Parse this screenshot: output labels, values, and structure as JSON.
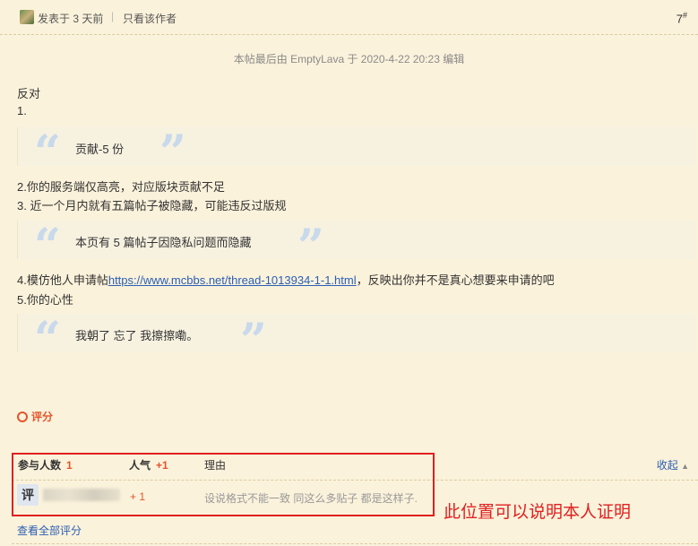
{
  "post_header": {
    "posted_prefix": "发表于",
    "posted_time": "3 天前",
    "separator": "|",
    "author_only": "只看该作者",
    "floor": "7",
    "floor_mark": "#"
  },
  "edit_notice": "本帖最后由 EmptyLava 于 2020-4-22 20:23 编辑",
  "content": {
    "line1": "反对",
    "line2": "1.",
    "quote1": "贡献-5 份",
    "line3": "2.你的服务端仅高亮，对应版块贡献不足",
    "line4": "3. 近一个月内就有五篇帖子被隐藏，可能违反过版规",
    "quote2": "本页有 5 篇帖子因隐私问题而隐藏",
    "line5_prefix": "4.模仿他人申请帖",
    "line5_link": "https://www.mcbbs.net/thread-1013934-1-1.html",
    "line5_suffix": "，反映出你并不是真心想要来申请的吧",
    "line6": "5.你的心性",
    "quote3": "我朝了 忘了 我擦擦嘞。"
  },
  "rating": {
    "toggle_label": "评分",
    "participants_label": "参与人数",
    "participants_count": "1",
    "popularity_label": "人气",
    "popularity_value": "+1",
    "reason_label": "理由",
    "collapse_label": "收起",
    "rows": [
      {
        "avatar_text": "评",
        "score": "+ 1",
        "reason": "设说格式不能一致 同这么多贴子 都是这样子."
      }
    ],
    "view_all": "查看全部评分"
  },
  "annotation": "此位置可以说明本人证明",
  "colors": {
    "accent_red": "#e4542b",
    "link_blue": "#2a5eb4",
    "box_red": "#e02020",
    "background": "#fbf2db"
  }
}
